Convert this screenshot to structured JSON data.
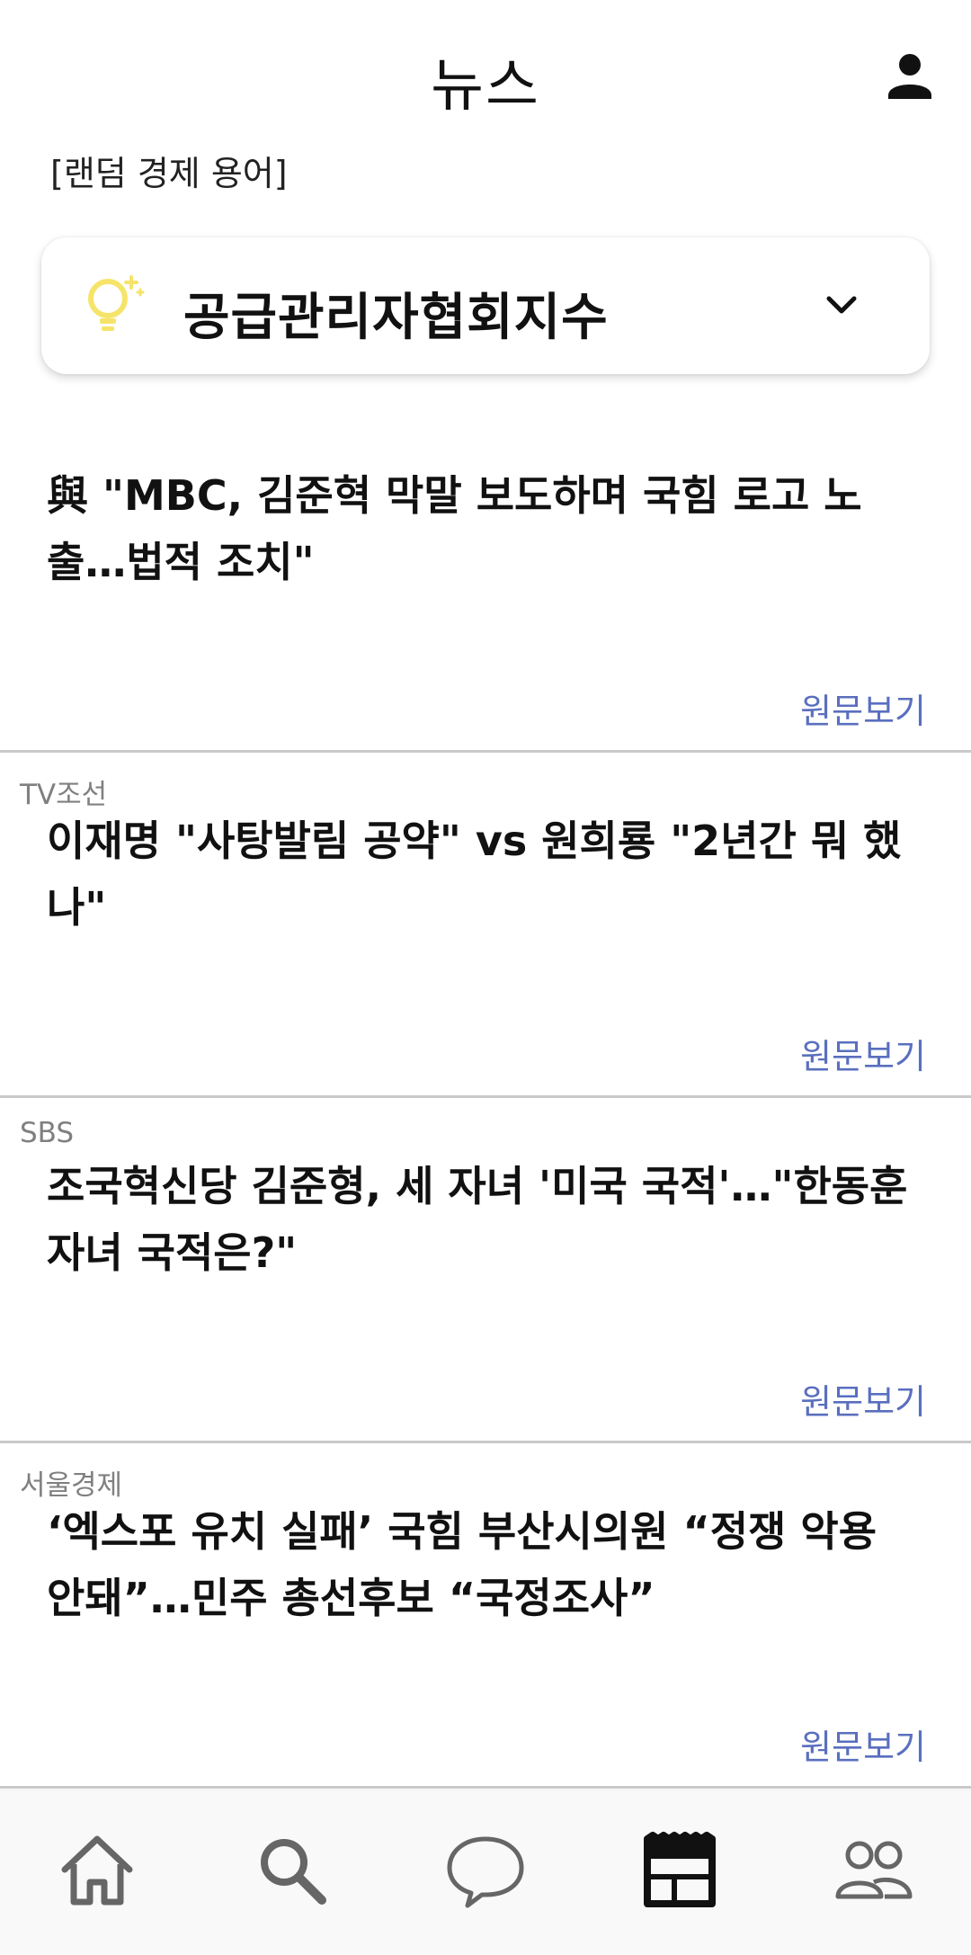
{
  "header": {
    "title": "뉴스",
    "profile_icon": "person-icon"
  },
  "term_section": {
    "label": "[랜덤 경제 용어]",
    "term": "공급관리자협회지수",
    "bulb_color": "#f6e46a"
  },
  "news": [
    {
      "source": "",
      "headline": "與 \"MBC, 김준혁 막말 보도하며 국힘 로고 노\n출…법적 조치\"",
      "link": "원문보기"
    },
    {
      "source": "TV조선",
      "headline": "이재명 \"사탕발림 공약\" vs 원희룡 \"2년간 뭐 했\n나\"",
      "link": "원문보기"
    },
    {
      "source": "SBS",
      "headline": "조국혁신당 김준형, 세 자녀 '미국 국적'…\"한동훈\n자녀 국적은?\"",
      "link": "원문보기"
    },
    {
      "source": "서울경제",
      "headline": "‘엑스포 유치 실패’ 국힘 부산시의원 “정쟁 악용\n안돼”…민주 총선후보 “국정조사”",
      "link": "원문보기"
    }
  ],
  "colors": {
    "link": "#5a6fbf",
    "source": "#808080",
    "divider": "#c9c9c9"
  },
  "bottom_nav": {
    "items": [
      {
        "icon": "home-icon",
        "active": false
      },
      {
        "icon": "search-icon",
        "active": false
      },
      {
        "icon": "chat-bubble-icon",
        "active": false
      },
      {
        "icon": "news-icon",
        "active": true
      },
      {
        "icon": "people-icon",
        "active": false
      }
    ]
  }
}
